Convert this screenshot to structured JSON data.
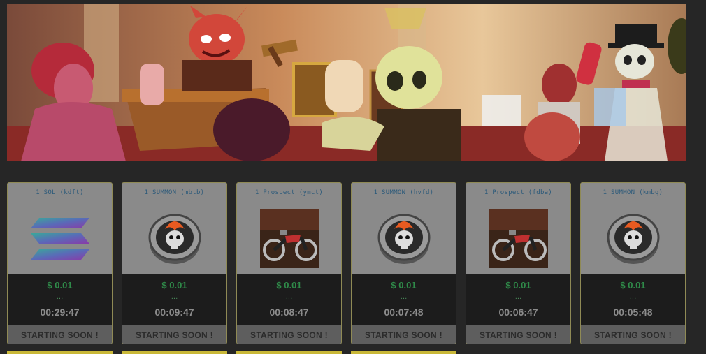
{
  "cards": [
    {
      "title": "1 SOL (kdft)",
      "image": "solana-logo",
      "price": "$ 0.01",
      "dots": "...",
      "timer": "00:29:47",
      "status": "STARTING SOON !"
    },
    {
      "title": "1 SUMMON (mbtb)",
      "image": "skull-coin",
      "price": "$ 0.01",
      "dots": "...",
      "timer": "00:09:47",
      "status": "STARTING SOON !"
    },
    {
      "title": "1 Prospect (ymct)",
      "image": "motorcycle",
      "price": "$ 0.01",
      "dots": "...",
      "timer": "00:08:47",
      "status": "STARTING SOON !"
    },
    {
      "title": "1 SUMMON (hvfd)",
      "image": "skull-coin",
      "price": "$ 0.01",
      "dots": "...",
      "timer": "00:07:48",
      "status": "STARTING SOON !"
    },
    {
      "title": "1 Prospect (fdba)",
      "image": "motorcycle",
      "price": "$ 0.01",
      "dots": "...",
      "timer": "00:06:47",
      "status": "STARTING SOON !"
    },
    {
      "title": "1 SUMMON (kmbq)",
      "image": "skull-coin",
      "price": "$ 0.01",
      "dots": "...",
      "timer": "00:05:48",
      "status": "STARTING SOON !"
    }
  ],
  "colors": {
    "price": "#2f8a49",
    "title": "#2c5a7a",
    "card_bg": "#8a8a8a",
    "page_bg": "#262626"
  }
}
